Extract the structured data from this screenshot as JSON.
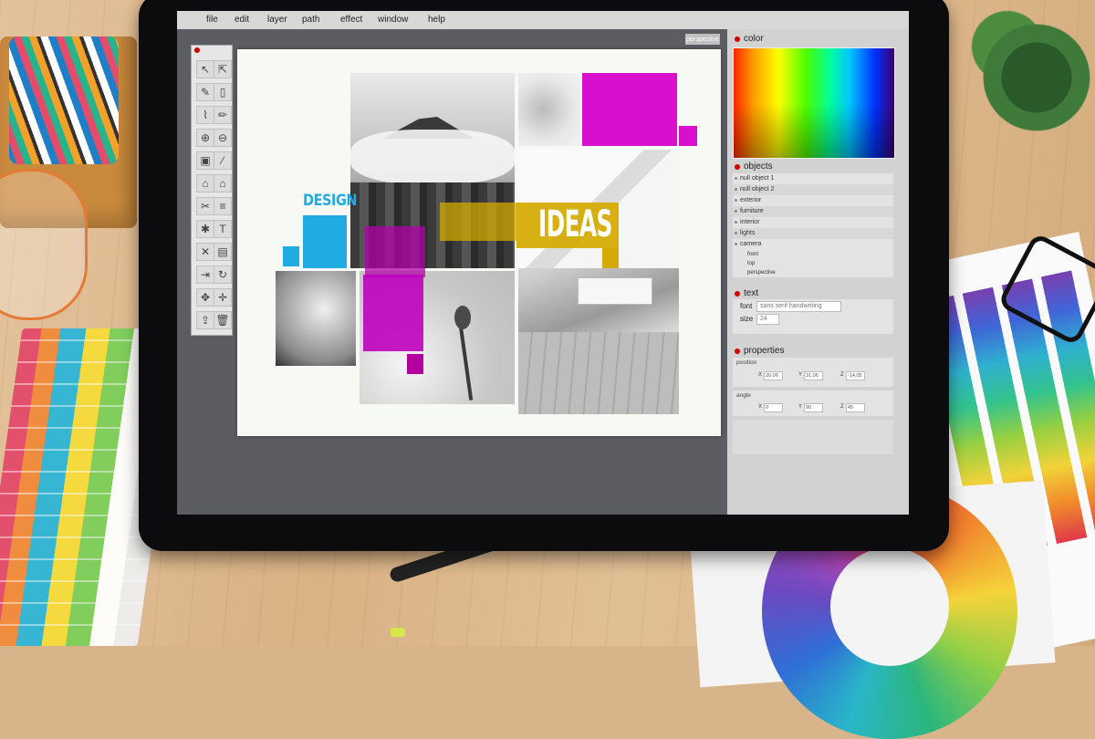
{
  "menubar": {
    "items": [
      "file",
      "edit",
      "layer",
      "path",
      "effect",
      "window",
      "help"
    ]
  },
  "toolbox": {
    "tools": [
      "select-arrow",
      "direct-select",
      "brush",
      "page",
      "eyedropper",
      "pencil",
      "zoom-in",
      "zoom-out",
      "lock",
      "magic-wand",
      "home",
      "house",
      "scissors",
      "database",
      "gear",
      "text",
      "crop",
      "save",
      "import",
      "rotate",
      "move",
      "transform",
      "export",
      "trash"
    ]
  },
  "canvas": {
    "perspective_button": "perspective",
    "design_text": "DESIGN",
    "ideas_text": "IDEAS",
    "accent_colors": {
      "magenta": "#d90fd0",
      "cyan": "#21abe3",
      "yellow": "#d4aa00"
    }
  },
  "panel": {
    "color": {
      "title": "color"
    },
    "objects": {
      "title": "objects",
      "items": [
        "null object 1",
        "null object 2",
        "exterior",
        "furniture",
        "interior",
        "lights",
        "camera"
      ],
      "camera_children": [
        "front",
        "top",
        "perspective"
      ]
    },
    "text": {
      "title": "text",
      "font_label": "font",
      "font_value": "sans serif handwriting",
      "size_label": "size",
      "size_value": "24"
    },
    "properties": {
      "title": "properties",
      "position_label": "position",
      "position": {
        "x_label": "X",
        "x": "20,06",
        "y_label": "Y",
        "y": "31,06",
        "z_label": "Z",
        "z": "-14,05"
      },
      "angle_label": "angle",
      "angle": {
        "x_label": "X",
        "x": "0",
        "y_label": "Y",
        "y": "90",
        "z_label": "Z",
        "z": "45"
      }
    }
  }
}
